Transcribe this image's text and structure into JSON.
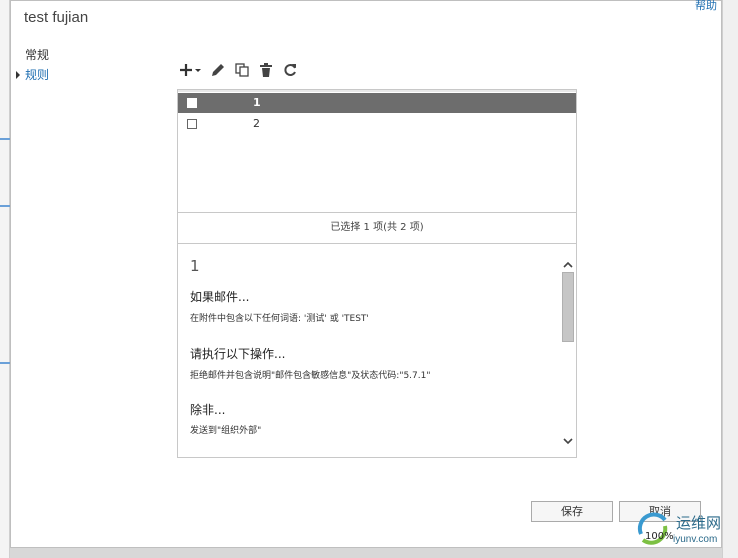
{
  "dialog": {
    "title": "test fujian",
    "help_label": "帮助"
  },
  "nav": {
    "items": [
      {
        "label": "常规",
        "active": false
      },
      {
        "label": "规则",
        "active": true
      }
    ]
  },
  "toolbar": {
    "icons": [
      "add-icon",
      "edit-icon",
      "copy-icon",
      "delete-icon",
      "refresh-icon"
    ]
  },
  "rules_list": {
    "rows": [
      {
        "name": "1",
        "selected": true
      },
      {
        "name": "2",
        "selected": false
      }
    ],
    "status": "已选择 1 项(共 2 项)"
  },
  "detail": {
    "title": "1",
    "condition_heading": "如果邮件...",
    "condition_text": "在附件中包含以下任何词语: '测试' 或 'TEST'",
    "action_heading": "请执行以下操作...",
    "action_text": "拒绝邮件并包含说明\"邮件包含敏感信息\"及状态代码:\"5.7.1\"",
    "exception_heading": "除非...",
    "exception_text": "发送到\"组织外部\""
  },
  "buttons": {
    "save_label": "保存",
    "cancel_label": "取消"
  },
  "watermark": {
    "text": "运维网",
    "url": "iyunv.com"
  },
  "status": {
    "zoom": "100%"
  },
  "colors": {
    "accent": "#1f6fb2",
    "selected_row": "#6d6d6d"
  }
}
